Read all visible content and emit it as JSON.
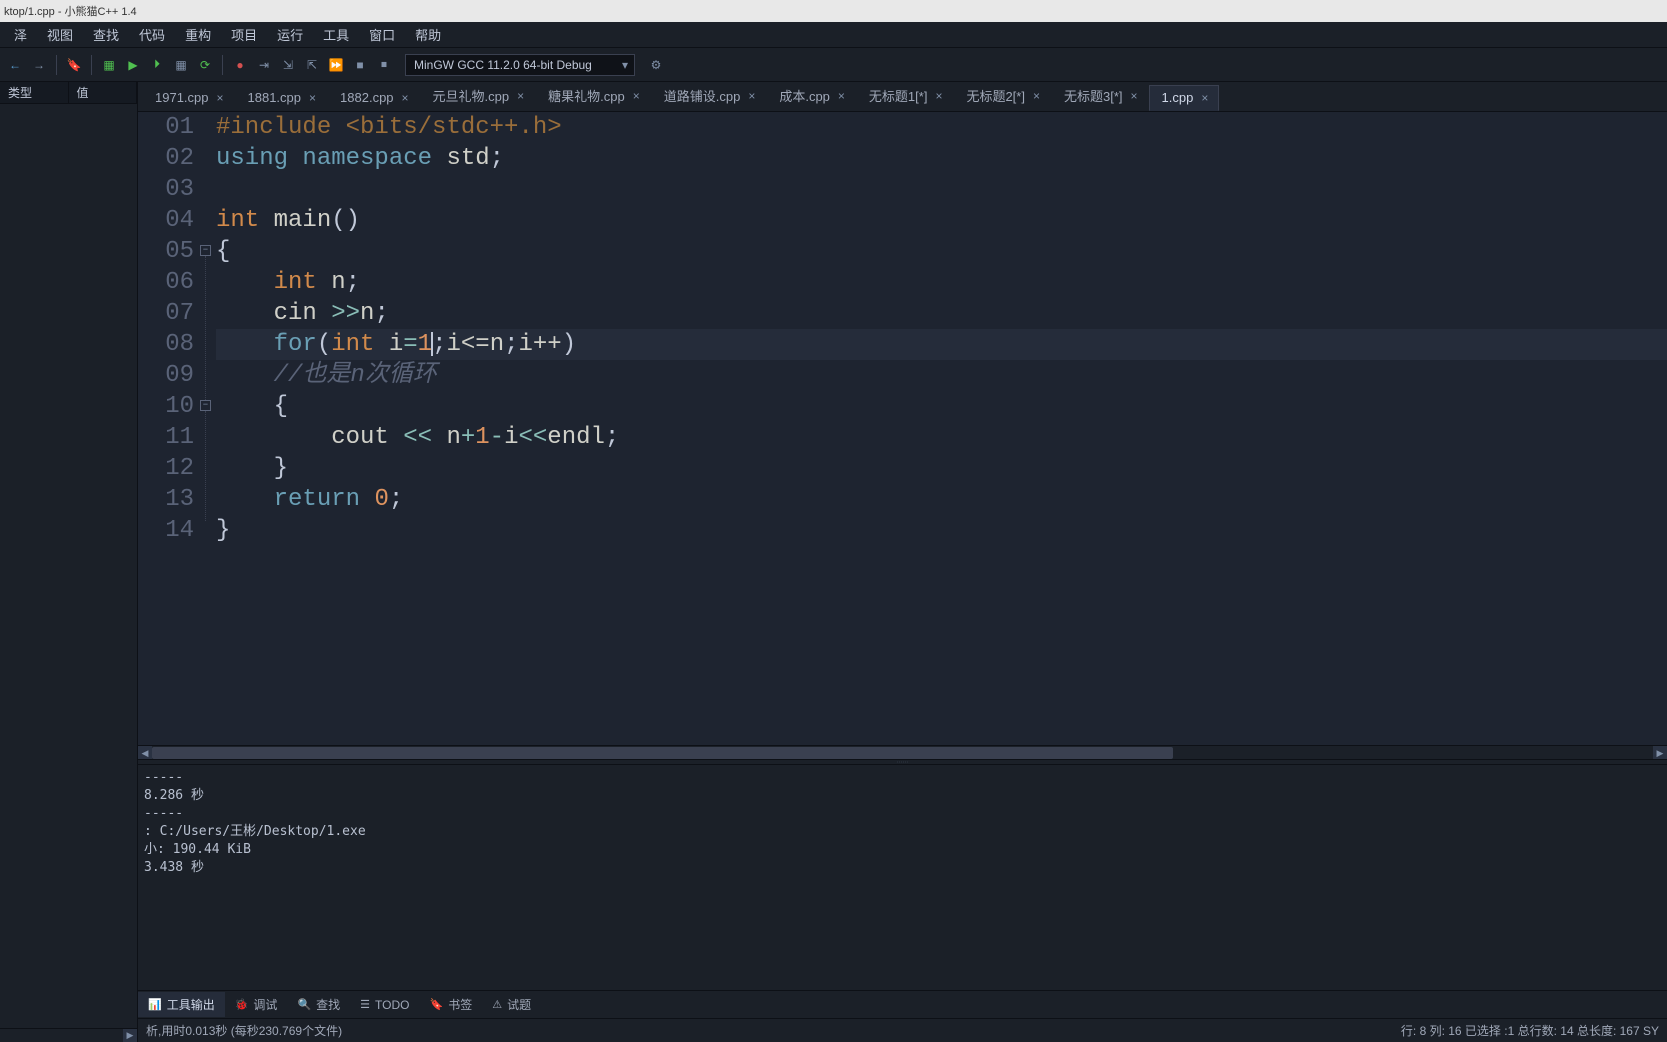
{
  "title": "ktop/1.cpp - 小熊猫C++ 1.4",
  "menu": [
    "泽",
    "视图",
    "查找",
    "代码",
    "重构",
    "项目",
    "运行",
    "工具",
    "窗口",
    "帮助"
  ],
  "compiler": "MinGW GCC 11.2.0 64-bit Debug",
  "sidepanel": {
    "col1": "类型",
    "col2": "值"
  },
  "tabs": [
    {
      "label": "1971.cpp",
      "active": false
    },
    {
      "label": "1881.cpp",
      "active": false
    },
    {
      "label": "1882.cpp",
      "active": false
    },
    {
      "label": "元旦礼物.cpp",
      "active": false
    },
    {
      "label": "糖果礼物.cpp",
      "active": false
    },
    {
      "label": "道路铺设.cpp",
      "active": false
    },
    {
      "label": "成本.cpp",
      "active": false
    },
    {
      "label": "无标题1[*]",
      "active": false
    },
    {
      "label": "无标题2[*]",
      "active": false
    },
    {
      "label": "无标题3[*]",
      "active": false
    },
    {
      "label": "1.cpp",
      "active": true
    }
  ],
  "gutter": [
    "01",
    "02",
    "03",
    "04",
    "05",
    "06",
    "07",
    "08",
    "09",
    "10",
    "11",
    "12",
    "13",
    "14"
  ],
  "code": {
    "l1": {
      "pp": "#include <bits/stdc++.h>"
    },
    "l2": {
      "kw1": "using",
      "kw2": "namespace",
      "id": "std",
      "sc": ";"
    },
    "l4": {
      "ty": "int",
      "fn": "main",
      "pa": "()"
    },
    "l5": {
      "br": "{"
    },
    "l6": {
      "ty": "int",
      "id": "n",
      "sc": ";"
    },
    "l7": {
      "id": "cin",
      "op": ">>",
      "id2": "n",
      "sc": ";"
    },
    "l8": {
      "kw": "for",
      "p1": "(",
      "ty": "int",
      "v": "i",
      "eq": "=",
      "n1": "1",
      "sc1": ";",
      "cond": "i<=n",
      "sc2": ";",
      "inc": "i++",
      "p2": ")"
    },
    "l9": {
      "cm": "//也是n次循环"
    },
    "l10": {
      "br": "{"
    },
    "l11": {
      "id": "cout",
      "op": "<<",
      "ex": "n",
      "op2": "+",
      "n1": "1",
      "op3": "-",
      "v": "i",
      "op4": "<<",
      "id2": "endl",
      "sc": ";"
    },
    "l12": {
      "br": "}"
    },
    "l13": {
      "kw": "return",
      "n": "0",
      "sc": ";"
    },
    "l14": {
      "br": "}"
    }
  },
  "console": [
    "-----",
    "",
    "8.286 秒",
    "",
    "",
    "-----",
    "",
    ": C:/Users/王彬/Desktop/1.exe",
    "小: 190.44 KiB",
    "3.438 秒"
  ],
  "bottomTabs": [
    {
      "icon": "📊",
      "label": "工具输出",
      "active": true
    },
    {
      "icon": "🐞",
      "label": "调试",
      "active": false
    },
    {
      "icon": "🔍",
      "label": "查找",
      "active": false
    },
    {
      "icon": "☰",
      "label": "TODO",
      "active": false
    },
    {
      "icon": "🔖",
      "label": "书签",
      "active": false
    },
    {
      "icon": "⚠",
      "label": "试题",
      "active": false
    }
  ],
  "status": {
    "left": "析,用时0.013秒 (每秒230.769个文件)",
    "right": "行: 8 列: 16 已选择 :1 总行数: 14 总长度: 167    SY"
  }
}
